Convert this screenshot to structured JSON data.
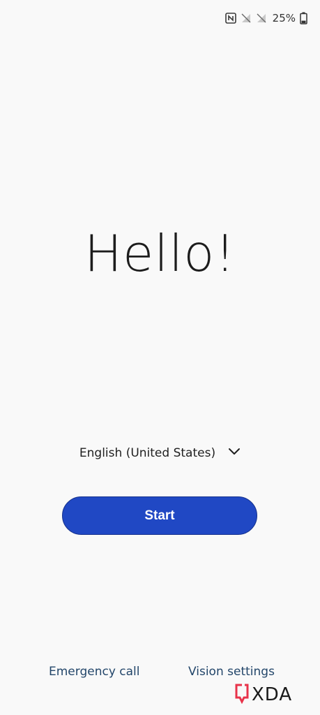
{
  "status_bar": {
    "icons": [
      "nfc-icon",
      "sim-1-no-signal-icon",
      "sim-2-no-signal-icon",
      "battery-icon"
    ],
    "battery_percent": "25%",
    "battery_level": 0.25
  },
  "welcome": {
    "title": "Hello!"
  },
  "language": {
    "selected": "English (United States)",
    "icon": "chevron-down-icon"
  },
  "actions": {
    "start_label": "Start"
  },
  "footer": {
    "emergency_call": "Emergency call",
    "vision_settings": "Vision settings"
  },
  "watermark": {
    "text": "XDA",
    "colors": {
      "bracket": "#e8334a",
      "text": "#1a1a1a"
    }
  },
  "colors": {
    "background": "#f9f9f9",
    "primary_button": "#2048c4",
    "link": "#23466a"
  }
}
